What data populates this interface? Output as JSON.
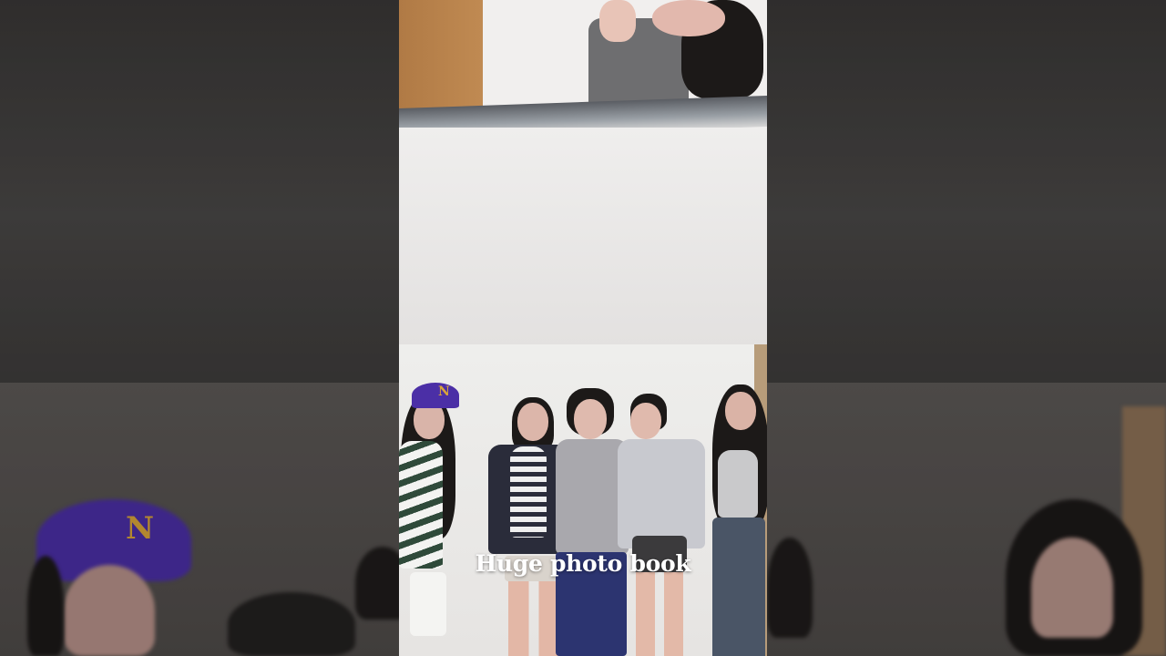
{
  "video": {
    "caption": "Huge photo book"
  },
  "colors": {
    "backdrop": "#2b2a2a",
    "cap": "#4b2fa6",
    "cap_logo": "#d9a53a",
    "caption_text": "#ffffff"
  },
  "icons": {
    "cap_logo": "N"
  }
}
